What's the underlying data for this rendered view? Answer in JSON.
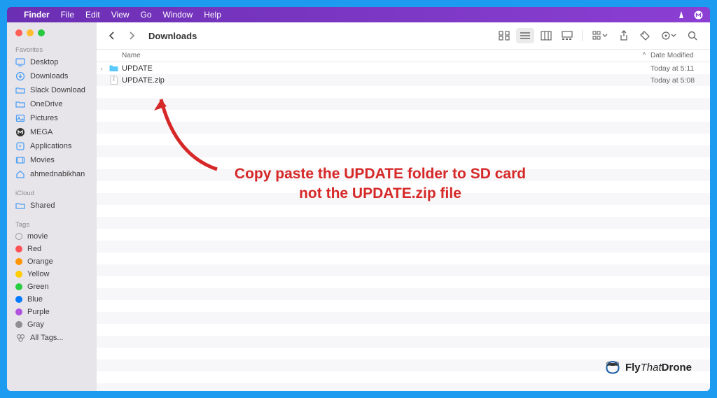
{
  "menubar": {
    "app": "Finder",
    "items": [
      "File",
      "Edit",
      "View",
      "Go",
      "Window",
      "Help"
    ]
  },
  "window": {
    "title": "Downloads"
  },
  "sidebar": {
    "favorites_header": "Favorites",
    "favorites": [
      {
        "icon": "desktop",
        "label": "Desktop"
      },
      {
        "icon": "download",
        "label": "Downloads"
      },
      {
        "icon": "folder",
        "label": "Slack Download"
      },
      {
        "icon": "folder",
        "label": "OneDrive"
      },
      {
        "icon": "pictures",
        "label": "Pictures"
      },
      {
        "icon": "mega",
        "label": "MEGA"
      },
      {
        "icon": "apps",
        "label": "Applications"
      },
      {
        "icon": "movies",
        "label": "Movies"
      },
      {
        "icon": "home",
        "label": "ahmednabikhan"
      }
    ],
    "icloud_header": "iCloud",
    "icloud": [
      {
        "icon": "shared",
        "label": "Shared"
      }
    ],
    "tags_header": "Tags",
    "tags": [
      {
        "color": "transparent",
        "border": "#9a9a9a",
        "label": "movie"
      },
      {
        "color": "#ff5257",
        "border": "#ff5257",
        "label": "Red"
      },
      {
        "color": "#ff9500",
        "border": "#ff9500",
        "label": "Orange"
      },
      {
        "color": "#ffcc00",
        "border": "#ffcc00",
        "label": "Yellow"
      },
      {
        "color": "#28cd41",
        "border": "#28cd41",
        "label": "Green"
      },
      {
        "color": "#007aff",
        "border": "#007aff",
        "label": "Blue"
      },
      {
        "color": "#af52de",
        "border": "#af52de",
        "label": "Purple"
      },
      {
        "color": "#8e8e93",
        "border": "#8e8e93",
        "label": "Gray"
      }
    ],
    "all_tags": "All Tags..."
  },
  "columns": {
    "name": "Name",
    "date_modified": "Date Modified"
  },
  "files": [
    {
      "type": "folder",
      "name": "UPDATE",
      "date": "Today at 5:11",
      "expandable": true
    },
    {
      "type": "zip",
      "name": "UPDATE.zip",
      "date": "Today at 5:08",
      "expandable": false
    }
  ],
  "annotation": {
    "line1": "Copy paste the UPDATE folder to SD card",
    "line2": "not the UPDATE.zip file"
  },
  "watermark": {
    "part1": "Fly",
    "part2": "That",
    "part3": "Drone"
  }
}
